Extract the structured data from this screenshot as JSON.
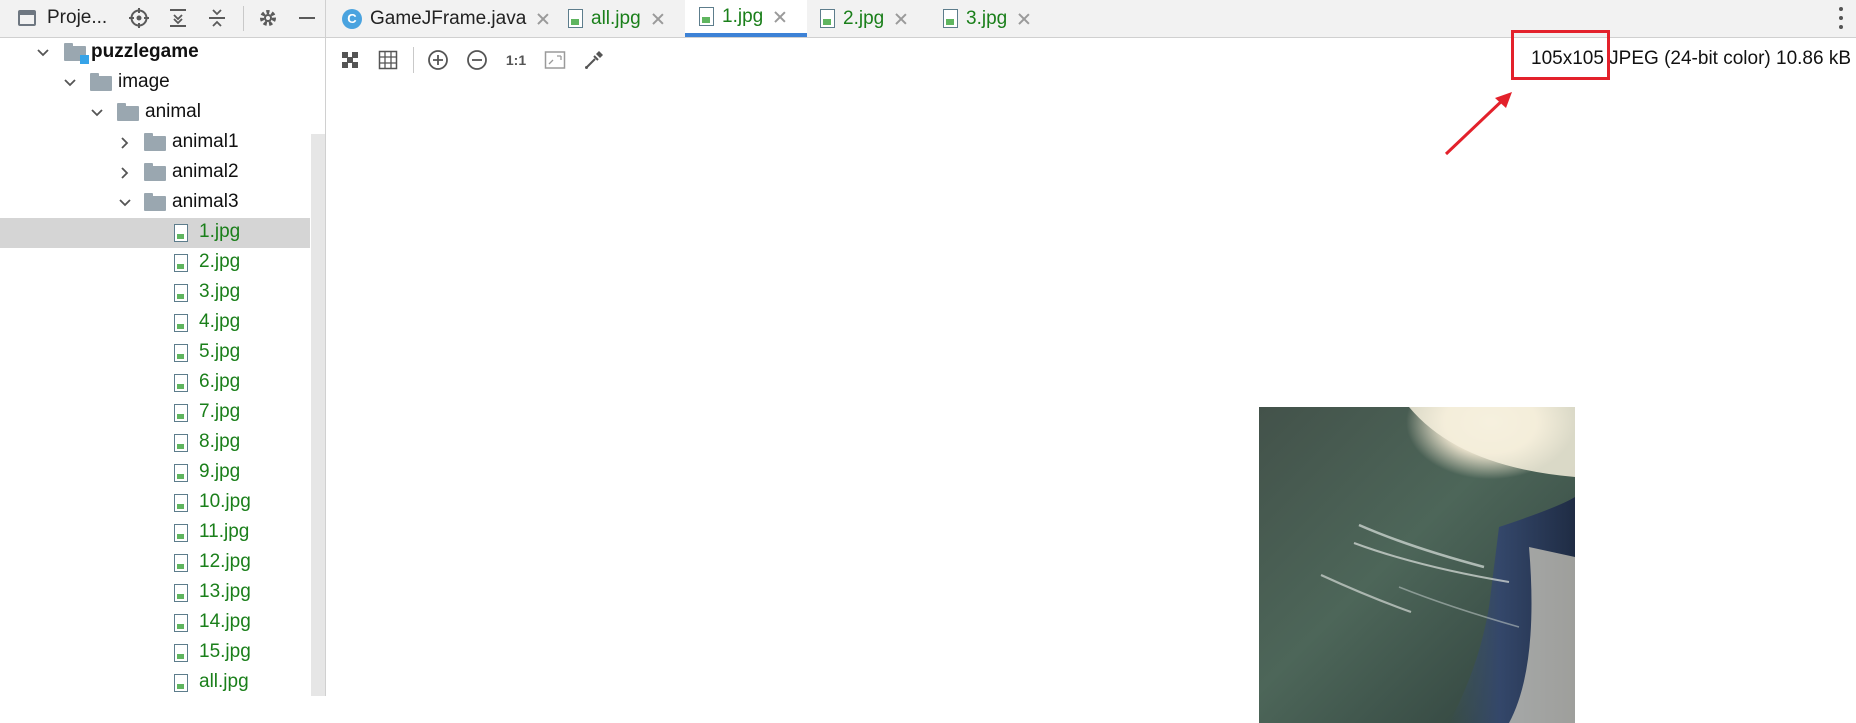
{
  "project_panel": {
    "title": "Proje...",
    "tools": [
      "locate-icon",
      "expand-all-icon",
      "collapse-all-icon",
      "gear-icon",
      "minimize-icon"
    ]
  },
  "tabs": [
    {
      "label": "GameJFrame.java",
      "icon": "java-class-icon",
      "active": false
    },
    {
      "label": "all.jpg",
      "icon": "image-file-icon",
      "active": false
    },
    {
      "label": "1.jpg",
      "icon": "image-file-icon",
      "active": true
    },
    {
      "label": "2.jpg",
      "icon": "image-file-icon",
      "active": false
    },
    {
      "label": "3.jpg",
      "icon": "image-file-icon",
      "active": false
    }
  ],
  "tree": {
    "root": "puzzlegame",
    "image": "image",
    "animal": "animal",
    "animal1": "animal1",
    "animal2": "animal2",
    "animal3": "animal3",
    "files": [
      "1.jpg",
      "2.jpg",
      "3.jpg",
      "4.jpg",
      "5.jpg",
      "6.jpg",
      "7.jpg",
      "8.jpg",
      "9.jpg",
      "10.jpg",
      "11.jpg",
      "12.jpg",
      "13.jpg",
      "14.jpg",
      "15.jpg",
      "all.jpg"
    ],
    "selected_file": "1.jpg"
  },
  "viewer": {
    "toolbar": [
      "fit-icon",
      "grid-icon",
      "zoom-in-icon",
      "zoom-out-icon",
      "actual-size",
      "fit-window-icon",
      "color-picker-icon"
    ],
    "actual_size_label": "1:1",
    "image_info": "105x105 JPEG (24-bit color) 10.86 kB"
  },
  "colors": {
    "accent": "#3d82d6",
    "file_green": "#1a7f1a",
    "annotation_red": "#e3212b"
  }
}
